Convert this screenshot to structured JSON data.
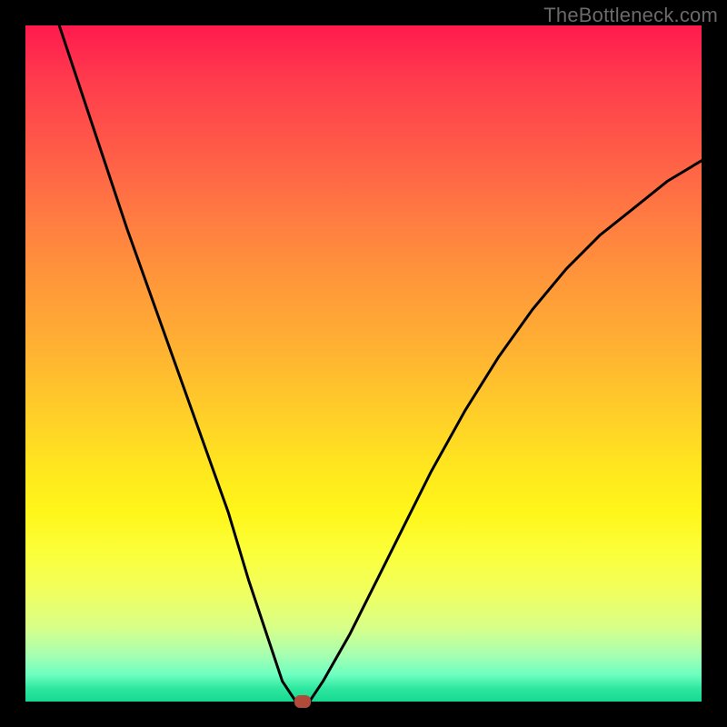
{
  "watermark": "TheBottleneck.com",
  "chart_data": {
    "type": "line",
    "title": "",
    "xlabel": "",
    "ylabel": "",
    "xlim": [
      0,
      100
    ],
    "ylim": [
      0,
      100
    ],
    "grid": false,
    "legend": false,
    "series": [
      {
        "name": "bottleneck-curve",
        "x": [
          5,
          10,
          15,
          20,
          25,
          30,
          33,
          36,
          38,
          40,
          42,
          44,
          48,
          52,
          56,
          60,
          65,
          70,
          75,
          80,
          85,
          90,
          95,
          100
        ],
        "y": [
          100,
          85,
          70,
          56,
          42,
          28,
          18,
          9,
          3,
          0,
          0,
          3,
          10,
          18,
          26,
          34,
          43,
          51,
          58,
          64,
          69,
          73,
          77,
          80
        ]
      }
    ],
    "marker": {
      "x": 41,
      "y": 0,
      "color": "#b24a3a"
    },
    "background_gradient": {
      "top": "#ff1a4d",
      "bottom": "#16d890"
    }
  }
}
